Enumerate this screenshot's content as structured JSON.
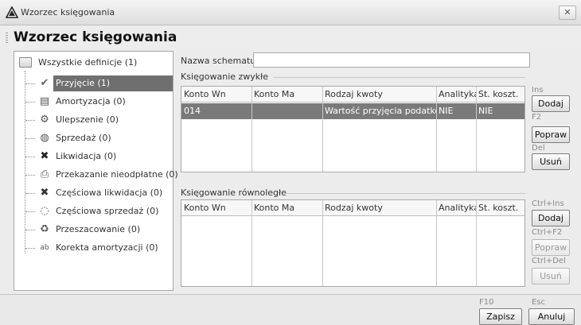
{
  "window": {
    "title": "Wzorzec księgowania",
    "close_glyph": "✕"
  },
  "header": {
    "title": "Wzorzec księgowania"
  },
  "tree": {
    "root_label": "Wszystkie definicje (1)",
    "items": [
      {
        "label": "Przyjęcie (1)",
        "icon": "check-icon",
        "glyph": "✔",
        "selected": true
      },
      {
        "label": "Amortyzacja (0)",
        "icon": "document-icon",
        "glyph": "▤"
      },
      {
        "label": "Ulepszenie (0)",
        "icon": "gears-icon",
        "glyph": "⚙"
      },
      {
        "label": "Sprzedaż (0)",
        "icon": "coins-icon",
        "glyph": "◍"
      },
      {
        "label": "Likwidacja (0)",
        "icon": "x-icon",
        "glyph": "✖"
      },
      {
        "label": "Przekazanie nieodpłatne (0)",
        "icon": "document-arrow-icon",
        "glyph": "⎙"
      },
      {
        "label": "Częściowa likwidacja (0)",
        "icon": "x-partial-icon",
        "glyph": "✖"
      },
      {
        "label": "Częściowa sprzedaż (0)",
        "icon": "coins-partial-icon",
        "glyph": "◌"
      },
      {
        "label": "Przeszacowanie (0)",
        "icon": "revalue-icon",
        "glyph": "♻"
      },
      {
        "label": "Korekta amortyzacji (0)",
        "icon": "abc-icon",
        "glyph": "ab"
      }
    ]
  },
  "schema": {
    "label": "Nazwa schematu:",
    "value": ""
  },
  "regular": {
    "label": "Księgowanie zwykłe",
    "columns": [
      "Konto Wn",
      "Konto Ma",
      "Rodzaj kwoty",
      "Analityka",
      "St. koszt."
    ],
    "rows": [
      [
        "014",
        "",
        "Wartość przyjęcia podatkowa",
        "NIE",
        "NIE"
      ]
    ],
    "buttons": {
      "add": {
        "key": "Ins",
        "label": "Dodaj"
      },
      "edit": {
        "key": "F2",
        "label": "Popraw"
      },
      "delete": {
        "key": "Del",
        "label": "Usuń"
      }
    }
  },
  "parallel": {
    "label": "Księgowanie równoległe",
    "columns": [
      "Konto Wn",
      "Konto Ma",
      "Rodzaj kwoty",
      "Analityka",
      "St. koszt."
    ],
    "rows": [],
    "buttons": {
      "add": {
        "key": "Ctrl+Ins",
        "label": "Dodaj"
      },
      "edit": {
        "key": "Ctrl+F2",
        "label": "Popraw"
      },
      "delete": {
        "key": "Ctrl+Del",
        "label": "Usuń"
      }
    }
  },
  "footer": {
    "save": {
      "key": "F10",
      "label": "Zapisz"
    },
    "cancel": {
      "key": "Esc",
      "label": "Anuluj"
    }
  }
}
